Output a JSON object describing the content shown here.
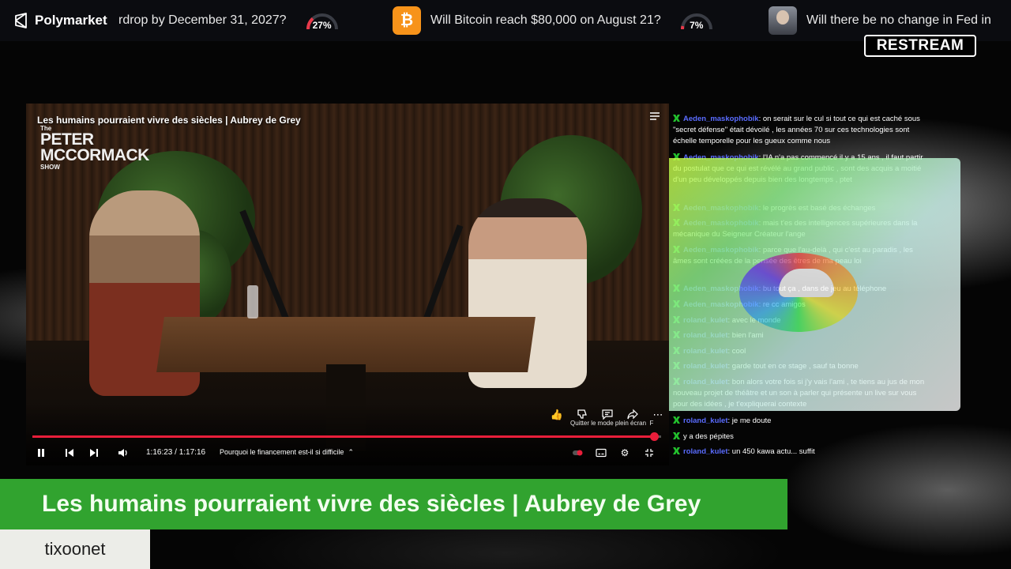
{
  "ticker": {
    "brand": "Polymarket",
    "items": [
      {
        "question": "rdrop by December 31, 2027?",
        "percent": "27%",
        "percent_value": 27,
        "gauge_color": "#e8394a"
      },
      {
        "icon": "bitcoin-icon",
        "coin_symbol": "₿",
        "question": "Will Bitcoin reach $80,000 on August 21?",
        "percent": "7%",
        "percent_value": 7,
        "gauge_color": "#e8394a"
      },
      {
        "icon": "avatar",
        "question": "Will there be no change in Fed in"
      }
    ]
  },
  "restream_logo": "RESTREAM",
  "player": {
    "video_title": "Les humains pourraient vivre des siècles | Aubrey de Grey",
    "show_logo": {
      "line1": "PETER",
      "line2": "MCCORMACK",
      "line3": "SHOW",
      "pre": "The"
    },
    "exit_fullscreen_hint": "Quitter le mode plein écran",
    "exit_fullscreen_key": "F",
    "timecode": "1:16:23 / 1:17:16",
    "chapter": "Pourquoi le financement est-il si difficile",
    "progress_fraction": 0.989,
    "accent": "#e91e3a"
  },
  "chat": {
    "badge_color": "#23c22e",
    "user_color": "#5a6cff",
    "messages": [
      {
        "user": "Aeden_maskophobik",
        "text": "on serait sur le cul si tout ce qui est caché sous \"secret défense\" était dévoilé , les années 70 sur ces technologies sont échelle temporelle pour les gueux comme nous"
      },
      {
        "user": "Aeden_maskophobik",
        "text": "l'IA n'a pas commencé il y a 15 ans , il faut partir du postulat que ce qui est révélé au grand public , sont des acquis a moitié d'un peu développés depuis bien des longtemps , ptet"
      },
      {
        "user": "Aeden_maskophobik",
        "text": "le progrès est basé des échanges"
      },
      {
        "user": "Aeden_maskophobik",
        "text": "mais t'es des intelligences supérieures dans la mécanique du Seigneur Créateur l'ange"
      },
      {
        "user": "Aeden_maskophobik",
        "text": "parce que l'au-delà , qui c'est au paradis , les âmes sont créées de la pensée des êtres de ma peau loi"
      },
      {
        "user": "Aeden_maskophobik",
        "text": "bu tout ça , dans de jeu au téléphone"
      },
      {
        "user": "Aeden_maskophobik",
        "text": "re cc amigos"
      },
      {
        "user": "roland_kulet",
        "text": "avec le monde"
      },
      {
        "user": "roland_kulet",
        "text": "bien l'ami"
      },
      {
        "user": "roland_kulet",
        "text": "cool"
      },
      {
        "user": "roland_kulet",
        "text": "garde tout en ce stage , sauf ta bonne"
      },
      {
        "user": "roland_kulet",
        "text": "bon alors votre fois si j'y vais l'ami , te tiens au jus de mon nouveau projet de théâtre et un son à parler qui présente un live sur vous pour des idées , je t'expliquerai contexte"
      },
      {
        "user": "roland_kulet",
        "text": "je me doute"
      },
      {
        "user": "",
        "text": "y a des pépites"
      },
      {
        "user": "roland_kulet",
        "text": "un 450 kawa actu... suffit"
      }
    ]
  },
  "lower_third": {
    "title": "Les humains pourraient vivre des siècles | Aubrey de Grey",
    "bar_color": "#31a32f"
  },
  "channel": {
    "name": "tixoonet"
  }
}
